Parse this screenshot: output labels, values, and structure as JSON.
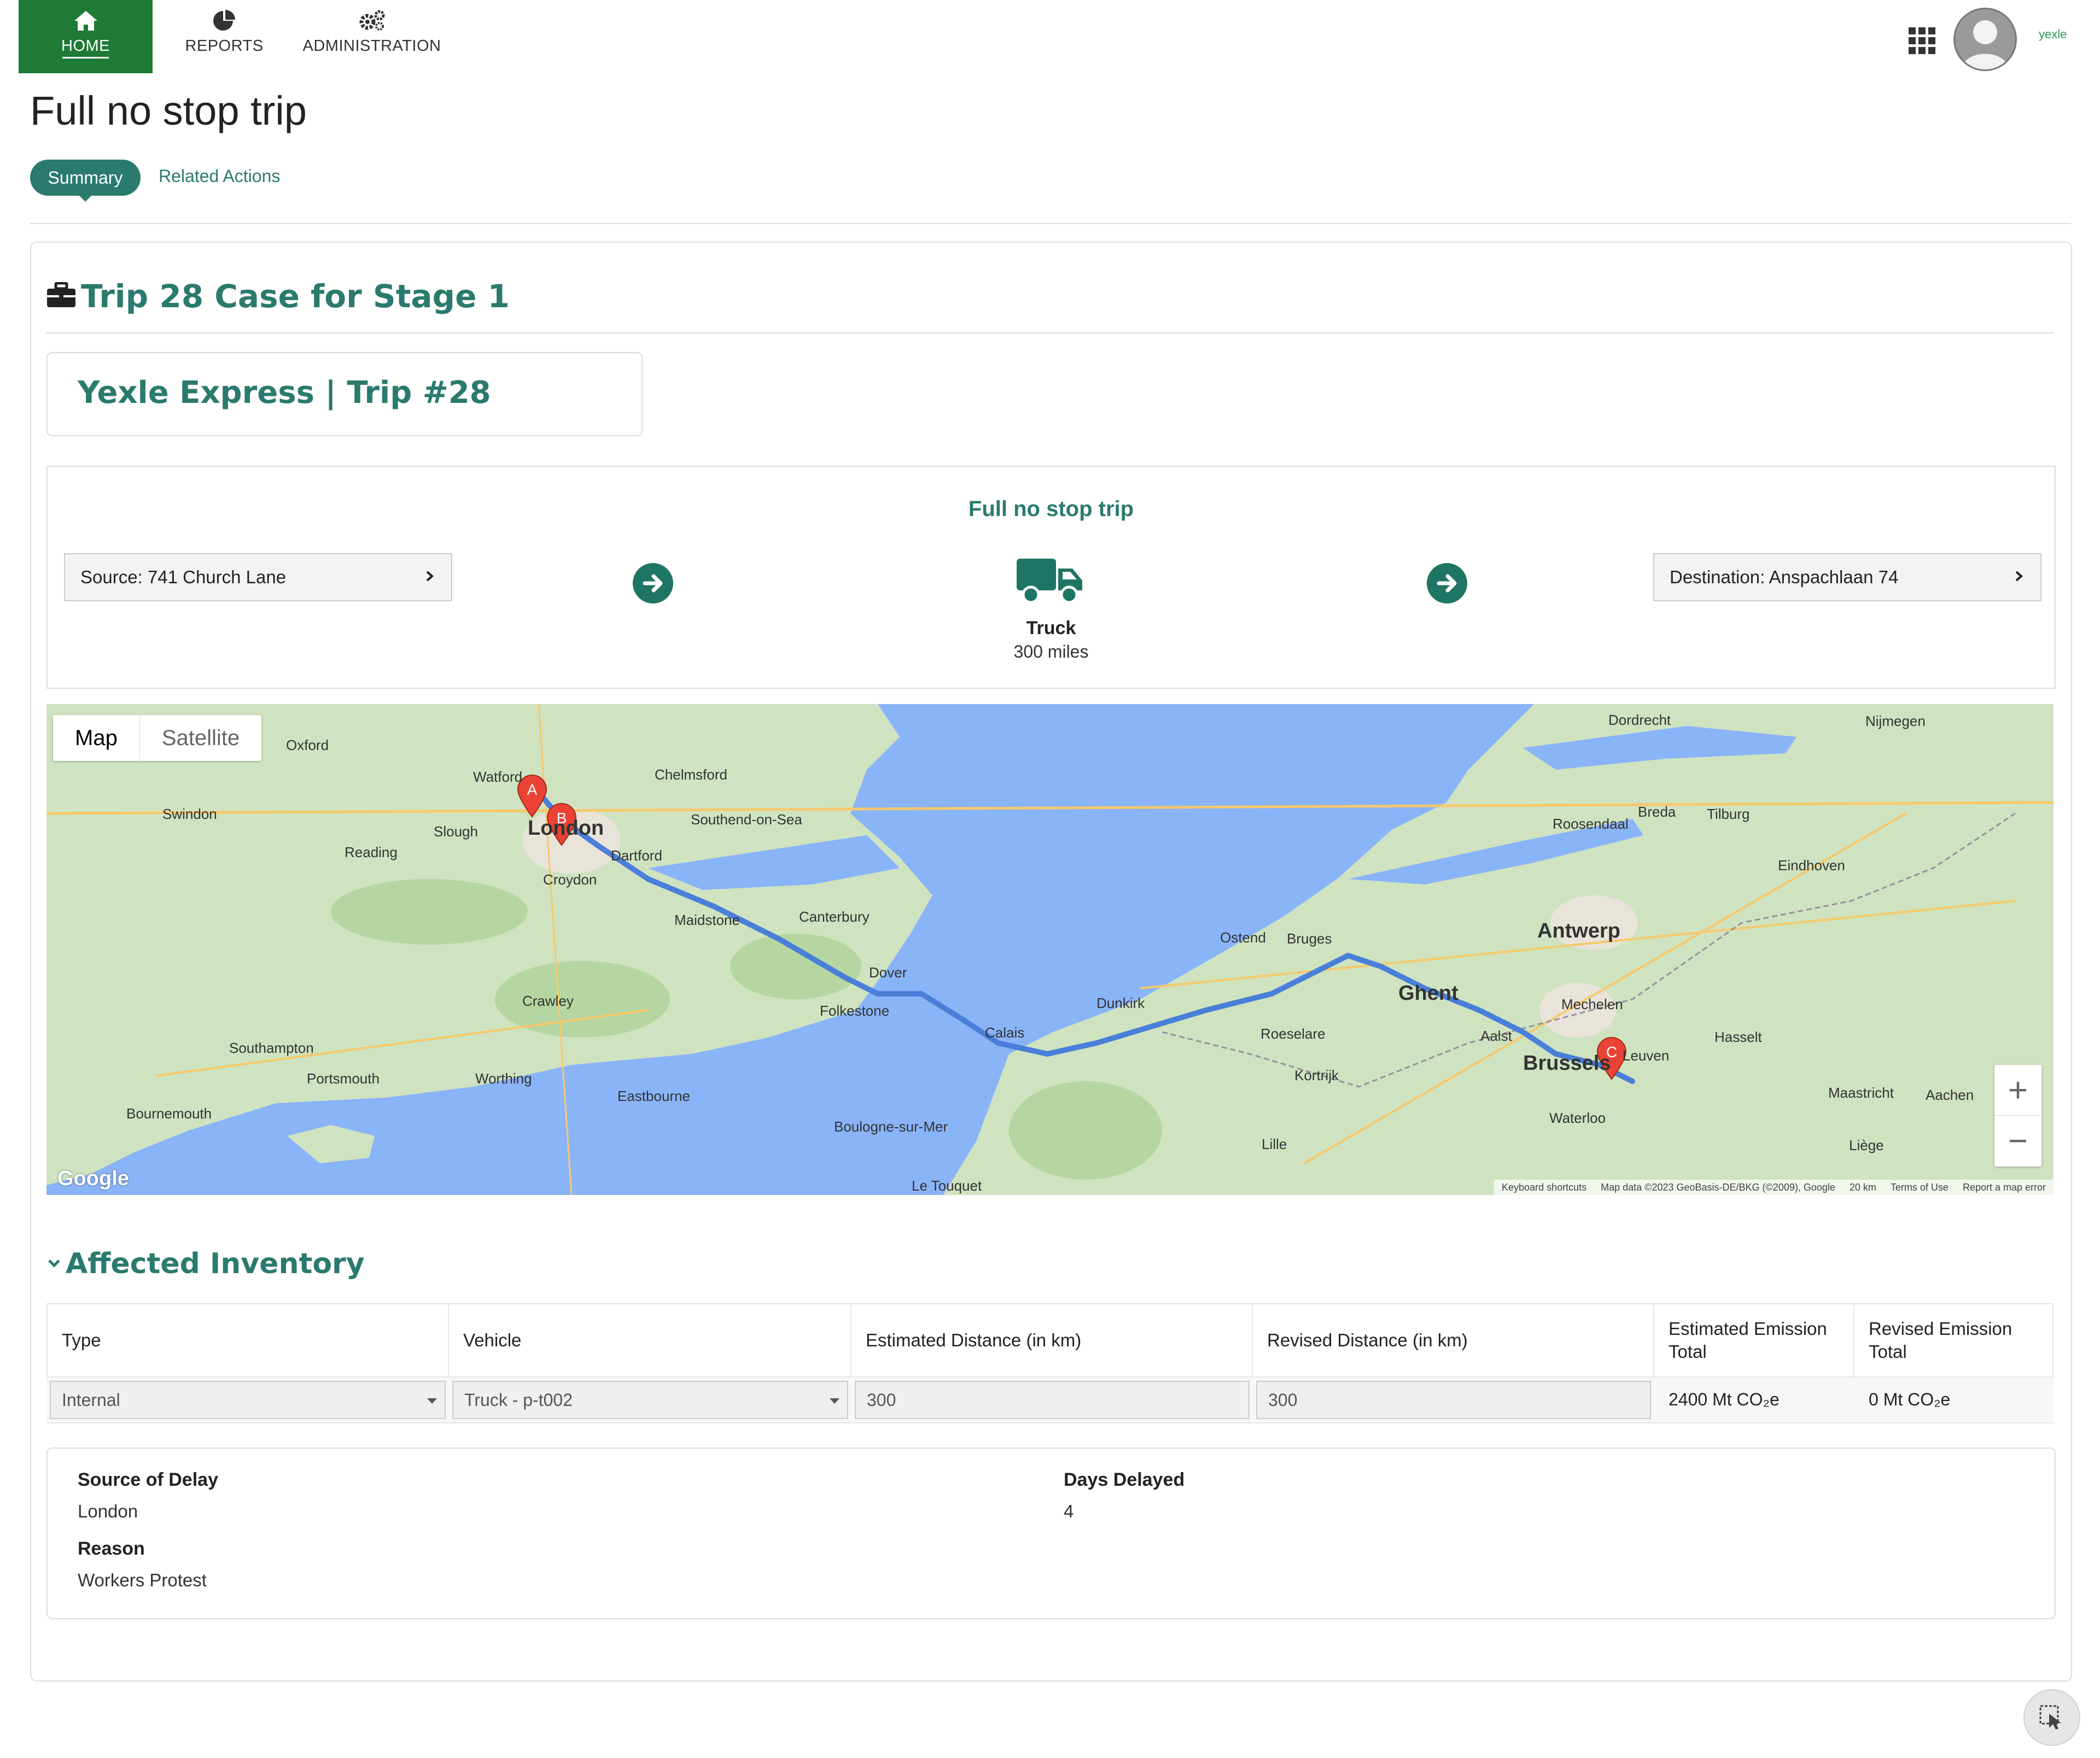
{
  "nav": {
    "home": "HOME",
    "reports": "REPORTS",
    "administration": "ADMINISTRATION",
    "brand": "yexle",
    "icons": [
      "home-icon",
      "pie-chart-icon",
      "gears-icon",
      "app-grid-icon",
      "user-avatar"
    ]
  },
  "page": {
    "title": "Full no stop trip",
    "tabs": [
      "Summary",
      "Related Actions"
    ]
  },
  "case": {
    "title": "Trip 28 Case for Stage 1",
    "icon": "briefcase-icon",
    "trip_header": "Yexle Express | Trip #28"
  },
  "route": {
    "title": "Full no stop trip",
    "source": "Source: 741 Church Lane",
    "destination": "Destination: Anspachlaan 74",
    "mode": "Truck",
    "distance": "300 miles"
  },
  "map": {
    "toggle": [
      "Map",
      "Satellite"
    ],
    "markers": [
      "A",
      "B",
      "C"
    ],
    "logo": "Google",
    "footer": [
      "Keyboard shortcuts",
      "Map data ©2023 GeoBasis-DE/BKG (©2009), Google",
      "20 km",
      "Terms of Use",
      "Report a map error"
    ],
    "cities": {
      "london": "London",
      "watford": "Watford",
      "slough": "Slough",
      "reading": "Reading",
      "oxford": "Oxford",
      "swindon": "Swindon",
      "chelmsford": "Chelmsford",
      "southend": "Southend-on-Sea",
      "dartford": "Dartford",
      "croydon": "Croydon",
      "maidstone": "Maidstone",
      "canterbury": "Canterbury",
      "dover": "Dover",
      "folkestone": "Folkestone",
      "crawley": "Crawley",
      "southampton": "Southampton",
      "portsmouth": "Portsmouth",
      "bournemouth": "Bournemouth",
      "brighton": "Worthing",
      "eastbourne": "Eastbourne",
      "calais": "Calais",
      "dunkirk": "Dunkirk",
      "bruges": "Bruges",
      "ghent": "Ghent",
      "antwerp": "Antwerp",
      "brussels": "Brussels",
      "leuven": "Leuven",
      "lille": "Lille",
      "breda": "Breda",
      "eindhoven": "Eindhoven",
      "dordrecht": "Dordrecht",
      "maastricht": "Maastricht",
      "liege": "Liège",
      "ostend": "Ostend",
      "kortrijk": "Kortrijk",
      "roeselare": "Roeselare",
      "mechelen": "Mechelen",
      "aalst": "Aalst",
      "hasselt": "Hasselt",
      "waterloo": "Waterloo",
      "tilburg": "Tilburg",
      "roosendaal": "Roosendaal",
      "boulogne": "Boulogne-sur-Mer",
      "letouquet": "Le Touquet",
      "nijmegen": "Nijmegen",
      "aachen": "Aachen"
    }
  },
  "inventory": {
    "title": "Affected Inventory",
    "headers": [
      "Type",
      "Vehicle",
      "Estimated Distance (in km)",
      "Revised Distance (in km)",
      "Estimated Emission Total",
      "Revised Emission Total"
    ],
    "row": {
      "type": "Internal",
      "vehicle": "Truck - p-t002",
      "est_distance": "300",
      "rev_distance": "300",
      "est_emission": "2400 Mt CO₂e",
      "rev_emission": "0 Mt CO₂e"
    }
  },
  "delay": {
    "source_label": "Source of Delay",
    "source_value": "London",
    "reason_label": "Reason",
    "reason_value": "Workers Protest",
    "days_label": "Days Delayed",
    "days_value": "4"
  },
  "colors": {
    "nav_green": "#1e7a35",
    "accent_teal": "#2a7a6e",
    "route_blue": "#4a7fd9",
    "marker_red": "#ea4335"
  }
}
